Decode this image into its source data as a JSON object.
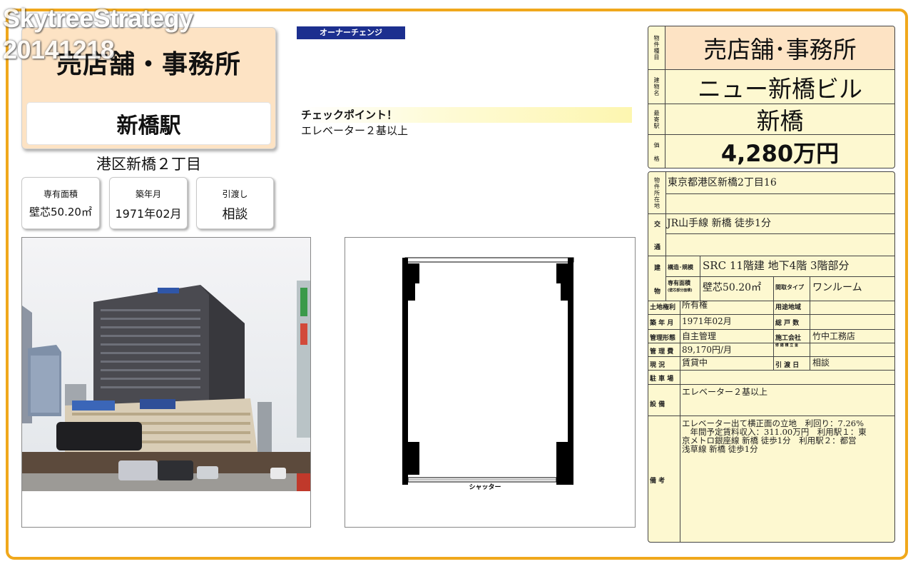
{
  "watermark": {
    "line1": "SkytreeStrategy",
    "line2": "20141218"
  },
  "header": {
    "property_type": "売店舗・事務所",
    "station": "新橋駅",
    "town": "港区新橋２丁目"
  },
  "info_boxes": [
    {
      "label": "専有面積",
      "value": "壁芯50.20㎡"
    },
    {
      "label": "築年月",
      "value": "1971年02月"
    },
    {
      "label": "引渡し",
      "value": "相談"
    }
  ],
  "owner_change": "オーナーチェンジ",
  "checkpoint": {
    "title": "チェックポイント！",
    "body": "エレベーター２基以上"
  },
  "floor_plan": {
    "shutter_label": "シャッター"
  },
  "summary": {
    "type_label": [
      "物",
      "件",
      "種",
      "目"
    ],
    "type": "売店舗･事務所",
    "building_label": [
      "建",
      "物",
      "名"
    ],
    "building": "ニュー新橋ビル",
    "station_label": [
      "最",
      "寄",
      "駅"
    ],
    "station": "新橋",
    "price_label": [
      "価",
      "格"
    ],
    "price": "4,280万円"
  },
  "details": {
    "location_label": [
      "物",
      "件",
      "所",
      "在",
      "地"
    ],
    "location": "東京都港区新橋2丁目16",
    "transport_label_1": "交",
    "transport_label_2": "通",
    "transport": "JR山手線 新橋 徒歩1分",
    "bldg_label_1": "建",
    "bldg_label_2": "物",
    "structure_label": "構造･規模",
    "structure": "SRC 11階建 地下4階 3階部分",
    "area_label": "専有面積",
    "area_sub": "(壁芯部分面積)",
    "area": "壁芯50.20㎡",
    "layout_label": "間取タイプ",
    "layout": "ワンルーム",
    "land_right_label": "土地権利",
    "land_right": "所有権",
    "zoning_label": "用途地域",
    "zoning": "",
    "built_label": "築 年 月",
    "built": "1971年02月",
    "units_label": "総 戸 数",
    "units": "",
    "management_label": "管理形態",
    "management": "自主管理",
    "builder_label": "施工会社",
    "builder": "竹中工務店",
    "fee_label": "管 理 費",
    "fee": "89,170円/月",
    "reserve_label": "修 繕 積 立 金",
    "reserve": "",
    "status_label": "現  況",
    "status": "賃貸中",
    "handover_label": "引 渡 日",
    "handover": "相談",
    "parking_label": "駐 車 場",
    "parking": "",
    "equipment_label": "設  備",
    "equipment": "エレベーター２基以上",
    "remarks_label": "備  考",
    "remarks": [
      "エレベーター出て横正面の立地　利回り：7.26%",
      "　年間予定賃料収入：311.00万円　利用駅１：東",
      "京メトロ銀座線 新橋 徒歩1分　利用駅２：都営",
      "浅草線 新橋 徒歩1分"
    ]
  },
  "colors": {
    "accent": "#f0a81c",
    "card_bg": "#fde3c4",
    "table_bg": "#fdf8d0",
    "badge_bg": "#1c2f8f"
  }
}
